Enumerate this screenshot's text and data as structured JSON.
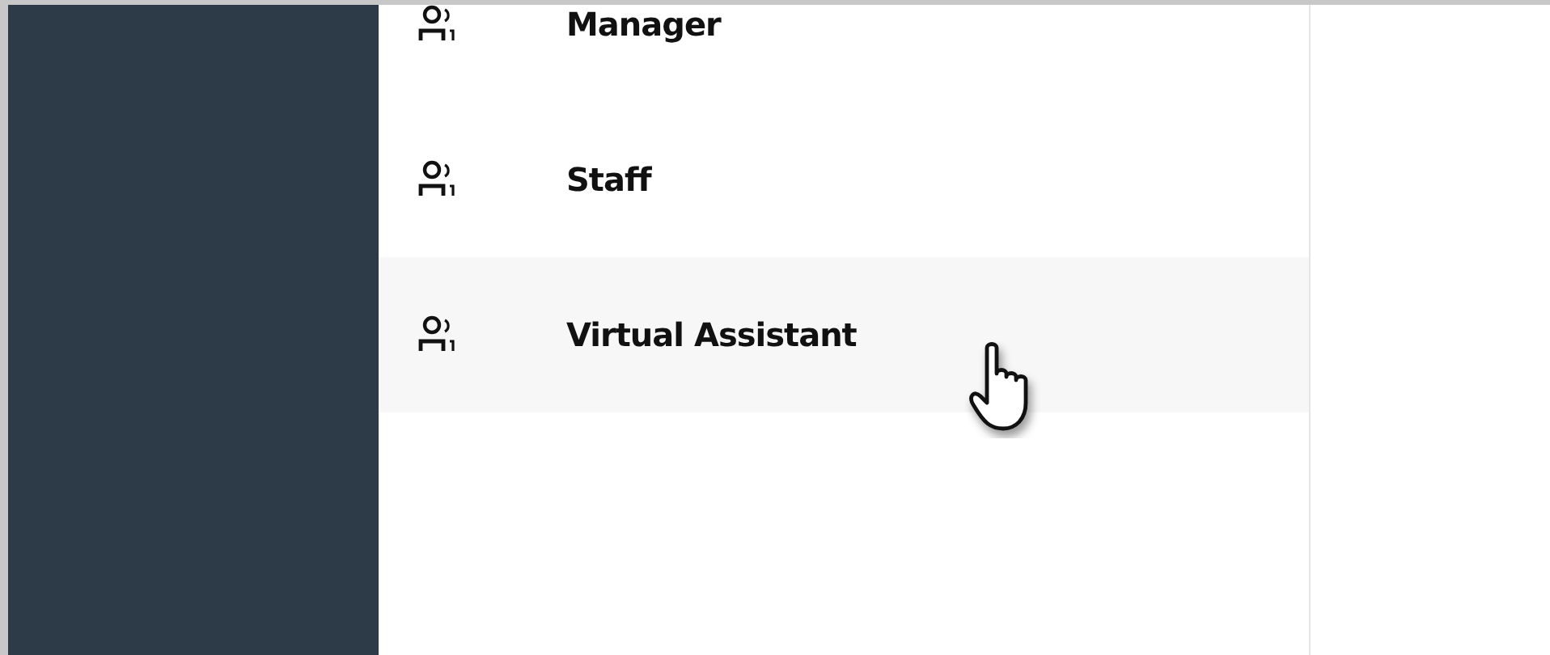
{
  "menu": {
    "items": [
      {
        "label": "Manager",
        "selected": false
      },
      {
        "label": "Staff",
        "selected": false
      },
      {
        "label": "Virtual Assistant",
        "selected": true
      }
    ]
  }
}
